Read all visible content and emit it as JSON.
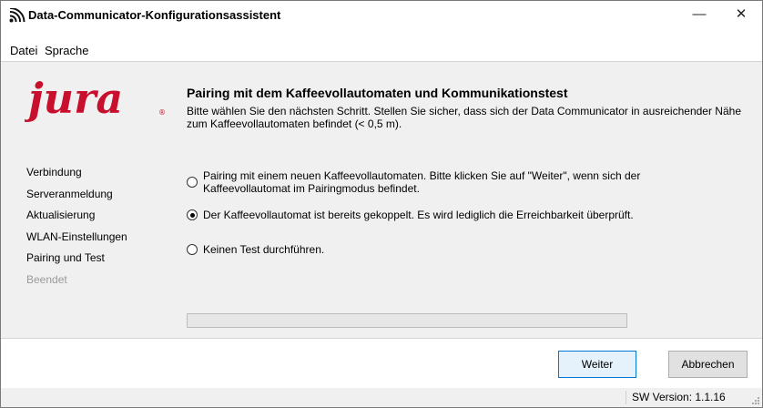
{
  "window": {
    "title": "Data-Communicator-Konfigurationsassistent",
    "minimize_glyph": "—",
    "close_glyph": "✕",
    "icon": "wifi-signal-icon"
  },
  "menu": {
    "items": [
      {
        "label": "Datei"
      },
      {
        "label": "Sprache"
      }
    ]
  },
  "brand": {
    "logo_text": "jura",
    "logo_color": "#c8102e"
  },
  "page": {
    "heading": "Pairing mit dem Kaffeevollautomaten und Kommunikationstest",
    "description": "Bitte wählen Sie den nächsten Schritt. Stellen Sie sicher, dass sich der Data Communicator in ausreichender Nähe zum Kaffeevollautomaten befindet (< 0,5 m)."
  },
  "steps": [
    {
      "label": "Verbindung",
      "state": "done"
    },
    {
      "label": "Serveranmeldung",
      "state": "done"
    },
    {
      "label": "Aktualisierung",
      "state": "done"
    },
    {
      "label": "WLAN-Einstellungen",
      "state": "done"
    },
    {
      "label": "Pairing und Test",
      "state": "current"
    },
    {
      "label": "Beendet",
      "state": "disabled"
    }
  ],
  "options": [
    {
      "label": "Pairing mit einem neuen Kaffeevollautomaten. Bitte klicken Sie auf \"Weiter\", wenn sich der Kaffeevollautomat im Pairingmodus befindet.",
      "selected": false
    },
    {
      "label": "Der Kaffeevollautomat ist bereits gekoppelt. Es wird lediglich die Erreichbarkeit überprüft.",
      "selected": true
    },
    {
      "label": "Keinen Test durchführen.",
      "selected": false
    }
  ],
  "progress": {
    "value": 0
  },
  "buttons": {
    "next_label": "Weiter",
    "cancel_label": "Abbrechen"
  },
  "status": {
    "version": "SW Version:  1.1.16"
  }
}
